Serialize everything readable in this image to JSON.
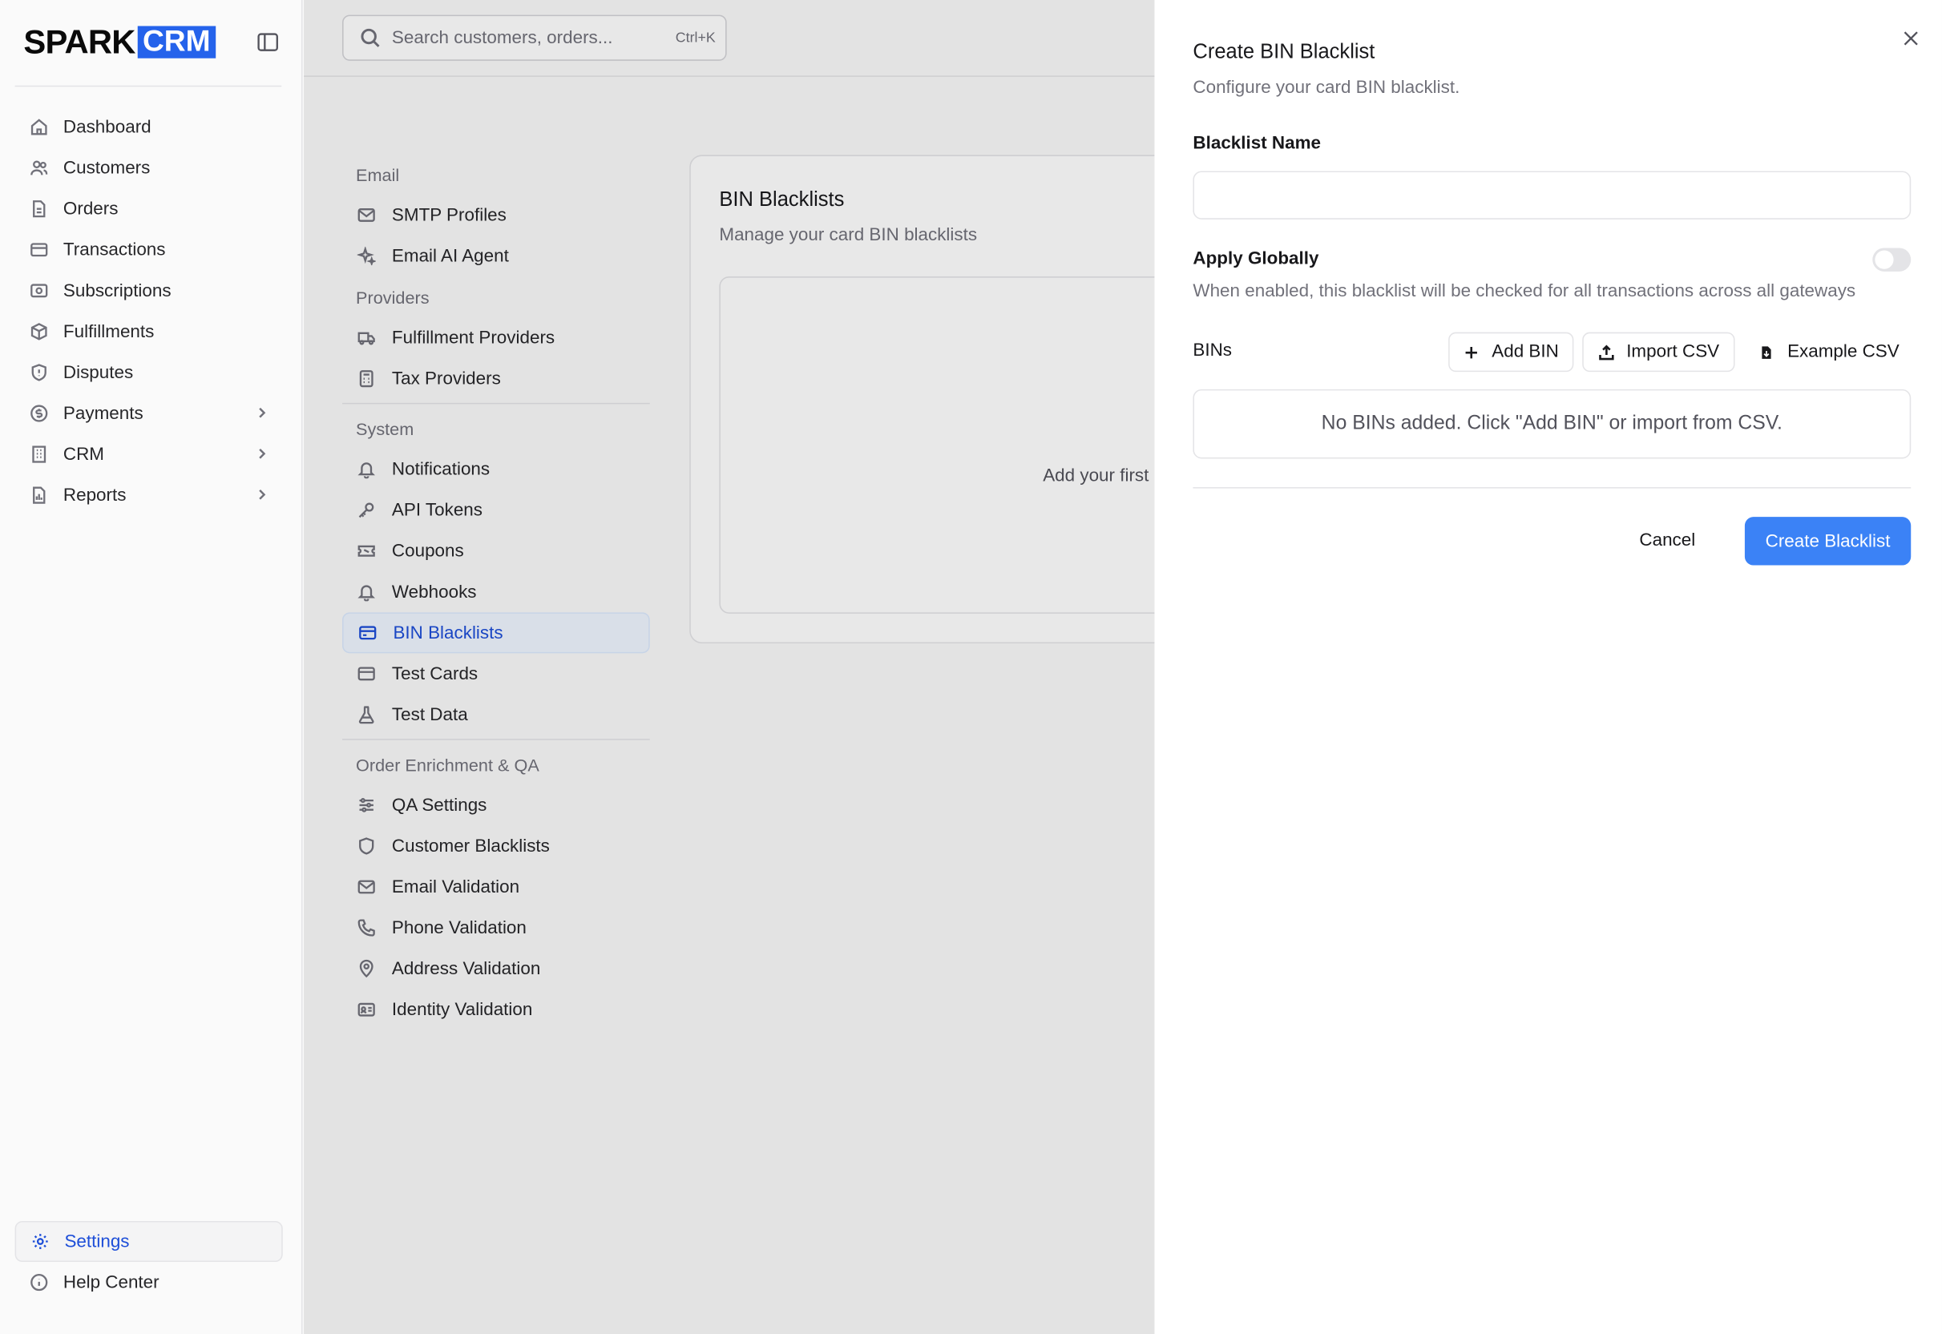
{
  "brand": {
    "spark": "SPARK",
    "crm": "CRM"
  },
  "sidebar": {
    "items": [
      {
        "label": "Dashboard"
      },
      {
        "label": "Customers"
      },
      {
        "label": "Orders"
      },
      {
        "label": "Transactions"
      },
      {
        "label": "Subscriptions"
      },
      {
        "label": "Fulfillments"
      },
      {
        "label": "Disputes"
      },
      {
        "label": "Payments"
      },
      {
        "label": "CRM"
      },
      {
        "label": "Reports"
      }
    ],
    "bottom": [
      {
        "label": "Settings"
      },
      {
        "label": "Help Center"
      }
    ]
  },
  "search": {
    "placeholder": "Search customers, orders...",
    "shortcut": "Ctrl+K"
  },
  "settings_nav": {
    "email_head": "Email",
    "smtp": "SMTP Profiles",
    "email_ai": "Email AI Agent",
    "providers_head": "Providers",
    "fulfillment": "Fulfillment Providers",
    "tax": "Tax Providers",
    "system_head": "System",
    "notifications": "Notifications",
    "api_tokens": "API Tokens",
    "coupons": "Coupons",
    "webhooks": "Webhooks",
    "bin_blacklists": "BIN Blacklists",
    "test_cards": "Test Cards",
    "test_data": "Test Data",
    "order_head": "Order Enrichment & QA",
    "qa_settings": "QA Settings",
    "customer_blacklists": "Customer Blacklists",
    "email_validation": "Email Validation",
    "phone_validation": "Phone Validation",
    "address_validation": "Address Validation",
    "identity_validation": "Identity Validation"
  },
  "card": {
    "title": "BIN Blacklists",
    "subtitle": "Manage your card BIN blacklists",
    "empty": "Add your first"
  },
  "panel": {
    "title": "Create BIN Blacklist",
    "subtitle": "Configure your card BIN blacklist.",
    "name_label": "Blacklist Name",
    "name_value": "",
    "global_label": "Apply Globally",
    "global_hint": "When enabled, this blacklist will be checked for all transactions across all gateways",
    "global_enabled": false,
    "bins_label": "BINs",
    "add_bin": "Add BIN",
    "import_csv": "Import CSV",
    "example_csv": "Example CSV",
    "empty_bins": "No BINs added. Click \"Add BIN\" or import from CSV.",
    "cancel": "Cancel",
    "create": "Create Blacklist"
  },
  "colors": {
    "accent": "#3b82f6",
    "active_text": "#1d4ed8",
    "brand": "#2563eb"
  }
}
